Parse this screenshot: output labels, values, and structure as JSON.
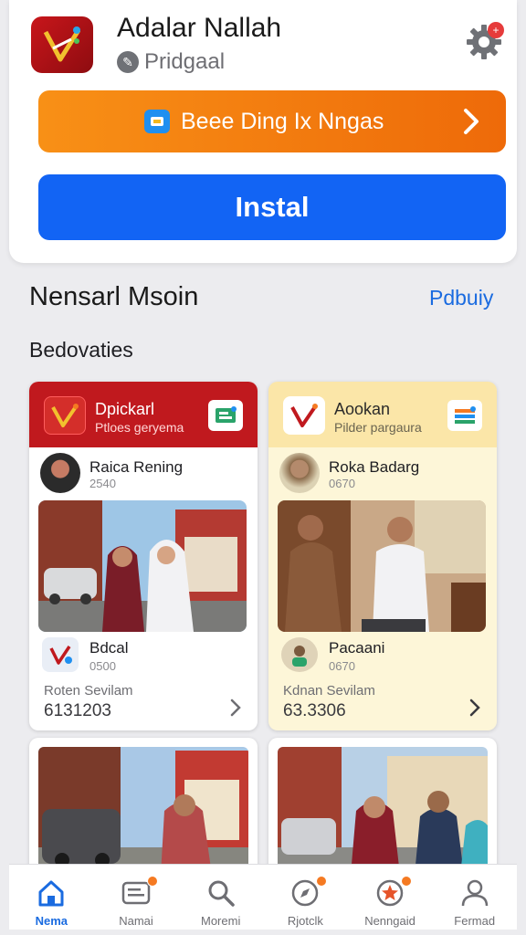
{
  "app": {
    "name": "Adalar Nallah",
    "developer": "Pridgaal"
  },
  "promo": {
    "label": "Beee Ding Ix Nngas"
  },
  "install": {
    "label": "Instal"
  },
  "section": {
    "title": "Nensarl Msoin",
    "link": "Pdbuiy",
    "subtitle": "Bedovaties"
  },
  "cards": [
    {
      "header_title": "Dpickarl",
      "header_sub": "Ptloes geryema",
      "author": "Raica Rening",
      "author_num": "2540",
      "item_title": "Bdcal",
      "item_num": "0500",
      "foot_label": "Roten Sevilam",
      "foot_value": "6131203"
    },
    {
      "header_title": "Aookan",
      "header_sub": "Pilder pargaura",
      "author": "Roka Badarg",
      "author_num": "0670",
      "item_title": "Pacaani",
      "item_num": "0670",
      "foot_label": "Kdnan Sevilam",
      "foot_value": "63.3306"
    }
  ],
  "tabs": [
    {
      "label": "Nema",
      "icon": "home-icon",
      "active": true
    },
    {
      "label": "Namai",
      "icon": "news-icon",
      "badge": true
    },
    {
      "label": "Moremi",
      "icon": "search-icon"
    },
    {
      "label": "Rjotclk",
      "icon": "compass-icon",
      "badge": true
    },
    {
      "label": "Nenngaid",
      "icon": "star-icon",
      "badge": true
    },
    {
      "label": "Fermad",
      "icon": "profile-icon"
    }
  ],
  "colors": {
    "accent": "#1264f4",
    "promo": "#f2800f",
    "brand_red": "#c0191e",
    "link": "#1a6be0"
  }
}
